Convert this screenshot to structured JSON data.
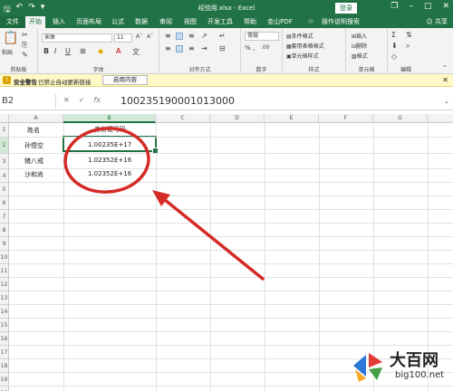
{
  "titlebar": {
    "title": "经验用.xlsx - Excel",
    "login": "登录",
    "qa_icons": [
      "save-icon",
      "undo-icon",
      "redo-icon"
    ],
    "window_buttons": [
      "restore-icon",
      "minimize-icon",
      "maximize-icon",
      "close-icon"
    ]
  },
  "tabs": [
    "文件",
    "开始",
    "插入",
    "页面布局",
    "公式",
    "数据",
    "审阅",
    "视图",
    "开发工具",
    "帮助",
    "金山PDF",
    "操作说明搜索"
  ],
  "share": "共享",
  "ribbon": {
    "paste": "粘贴",
    "clipboard": "剪贴板",
    "font_name": "宋体",
    "font_size": "11",
    "font_group": "字体",
    "align_group": "对齐方式",
    "number_format": "常规",
    "number_group": "数字",
    "cond_format": "条件格式",
    "table_format": "套用表格格式",
    "cell_style": "单元格样式",
    "style_group": "样式",
    "insert": "插入",
    "delete": "删除",
    "format": "格式",
    "cells_group": "单元格",
    "edit_group": "编辑"
  },
  "security": {
    "title": "安全警告",
    "message": "已禁止自动更新链接",
    "button": "启用内容"
  },
  "formula_bar": {
    "name_box": "B2",
    "formula": "100235190001013000"
  },
  "columns": [
    "A",
    "B",
    "C",
    "D",
    "E",
    "F",
    "G"
  ],
  "rows": [
    "1",
    "2",
    "3",
    "4",
    "5",
    "6",
    "7",
    "8",
    "9",
    "10",
    "11",
    "12",
    "13",
    "14",
    "15",
    "16",
    "17",
    "18",
    "19",
    "20"
  ],
  "cells": {
    "A1": "姓名",
    "B1": "身份证号码",
    "A2": "孙悟空",
    "B2": "1.00235E+17",
    "A3": "猪八戒",
    "B3": "1.02352E+16",
    "A4": "沙和尚",
    "B4": "1.02352E+16"
  },
  "annotation_color": "#d42b26",
  "header_color": "#217346",
  "watermark": {
    "brand": "大百网",
    "domain": "big100.net"
  }
}
